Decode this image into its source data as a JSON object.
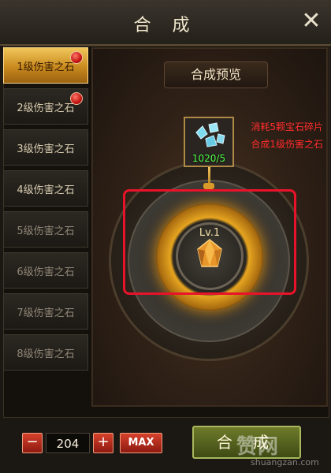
{
  "window": {
    "title": "合 成",
    "close_label": "✕"
  },
  "gem_list": [
    {
      "label": "1级伤害之石",
      "selected": true,
      "has_alert": true,
      "enabled": true
    },
    {
      "label": "2级伤害之石",
      "selected": false,
      "has_alert": true,
      "enabled": true
    },
    {
      "label": "3级伤害之石",
      "selected": false,
      "has_alert": false,
      "enabled": true
    },
    {
      "label": "4级伤害之石",
      "selected": false,
      "has_alert": false,
      "enabled": true
    },
    {
      "label": "5级伤害之石",
      "selected": false,
      "has_alert": false,
      "enabled": false
    },
    {
      "label": "6级伤害之石",
      "selected": false,
      "has_alert": false,
      "enabled": false
    },
    {
      "label": "7级伤害之石",
      "selected": false,
      "has_alert": false,
      "enabled": false
    },
    {
      "label": "8级伤害之石",
      "selected": false,
      "has_alert": false,
      "enabled": false
    }
  ],
  "preview": {
    "header": "合成预览",
    "material_count": "1020/5",
    "result_level": "Lv.1",
    "annotation_line1": "消耗5颗宝石碎片",
    "annotation_line2": "合成1级伤害之石"
  },
  "controls": {
    "minus": "−",
    "quantity": "204",
    "plus": "+",
    "max": "MAX",
    "synthesize": "合 成"
  },
  "watermark": {
    "main": "赞网",
    "sub": "shuangzan.com"
  },
  "colors": {
    "accent_gold": "#e6a520",
    "annotation_red": "#e8132a",
    "count_green": "#52ff4a",
    "synth_button": "#6e7b2a"
  }
}
